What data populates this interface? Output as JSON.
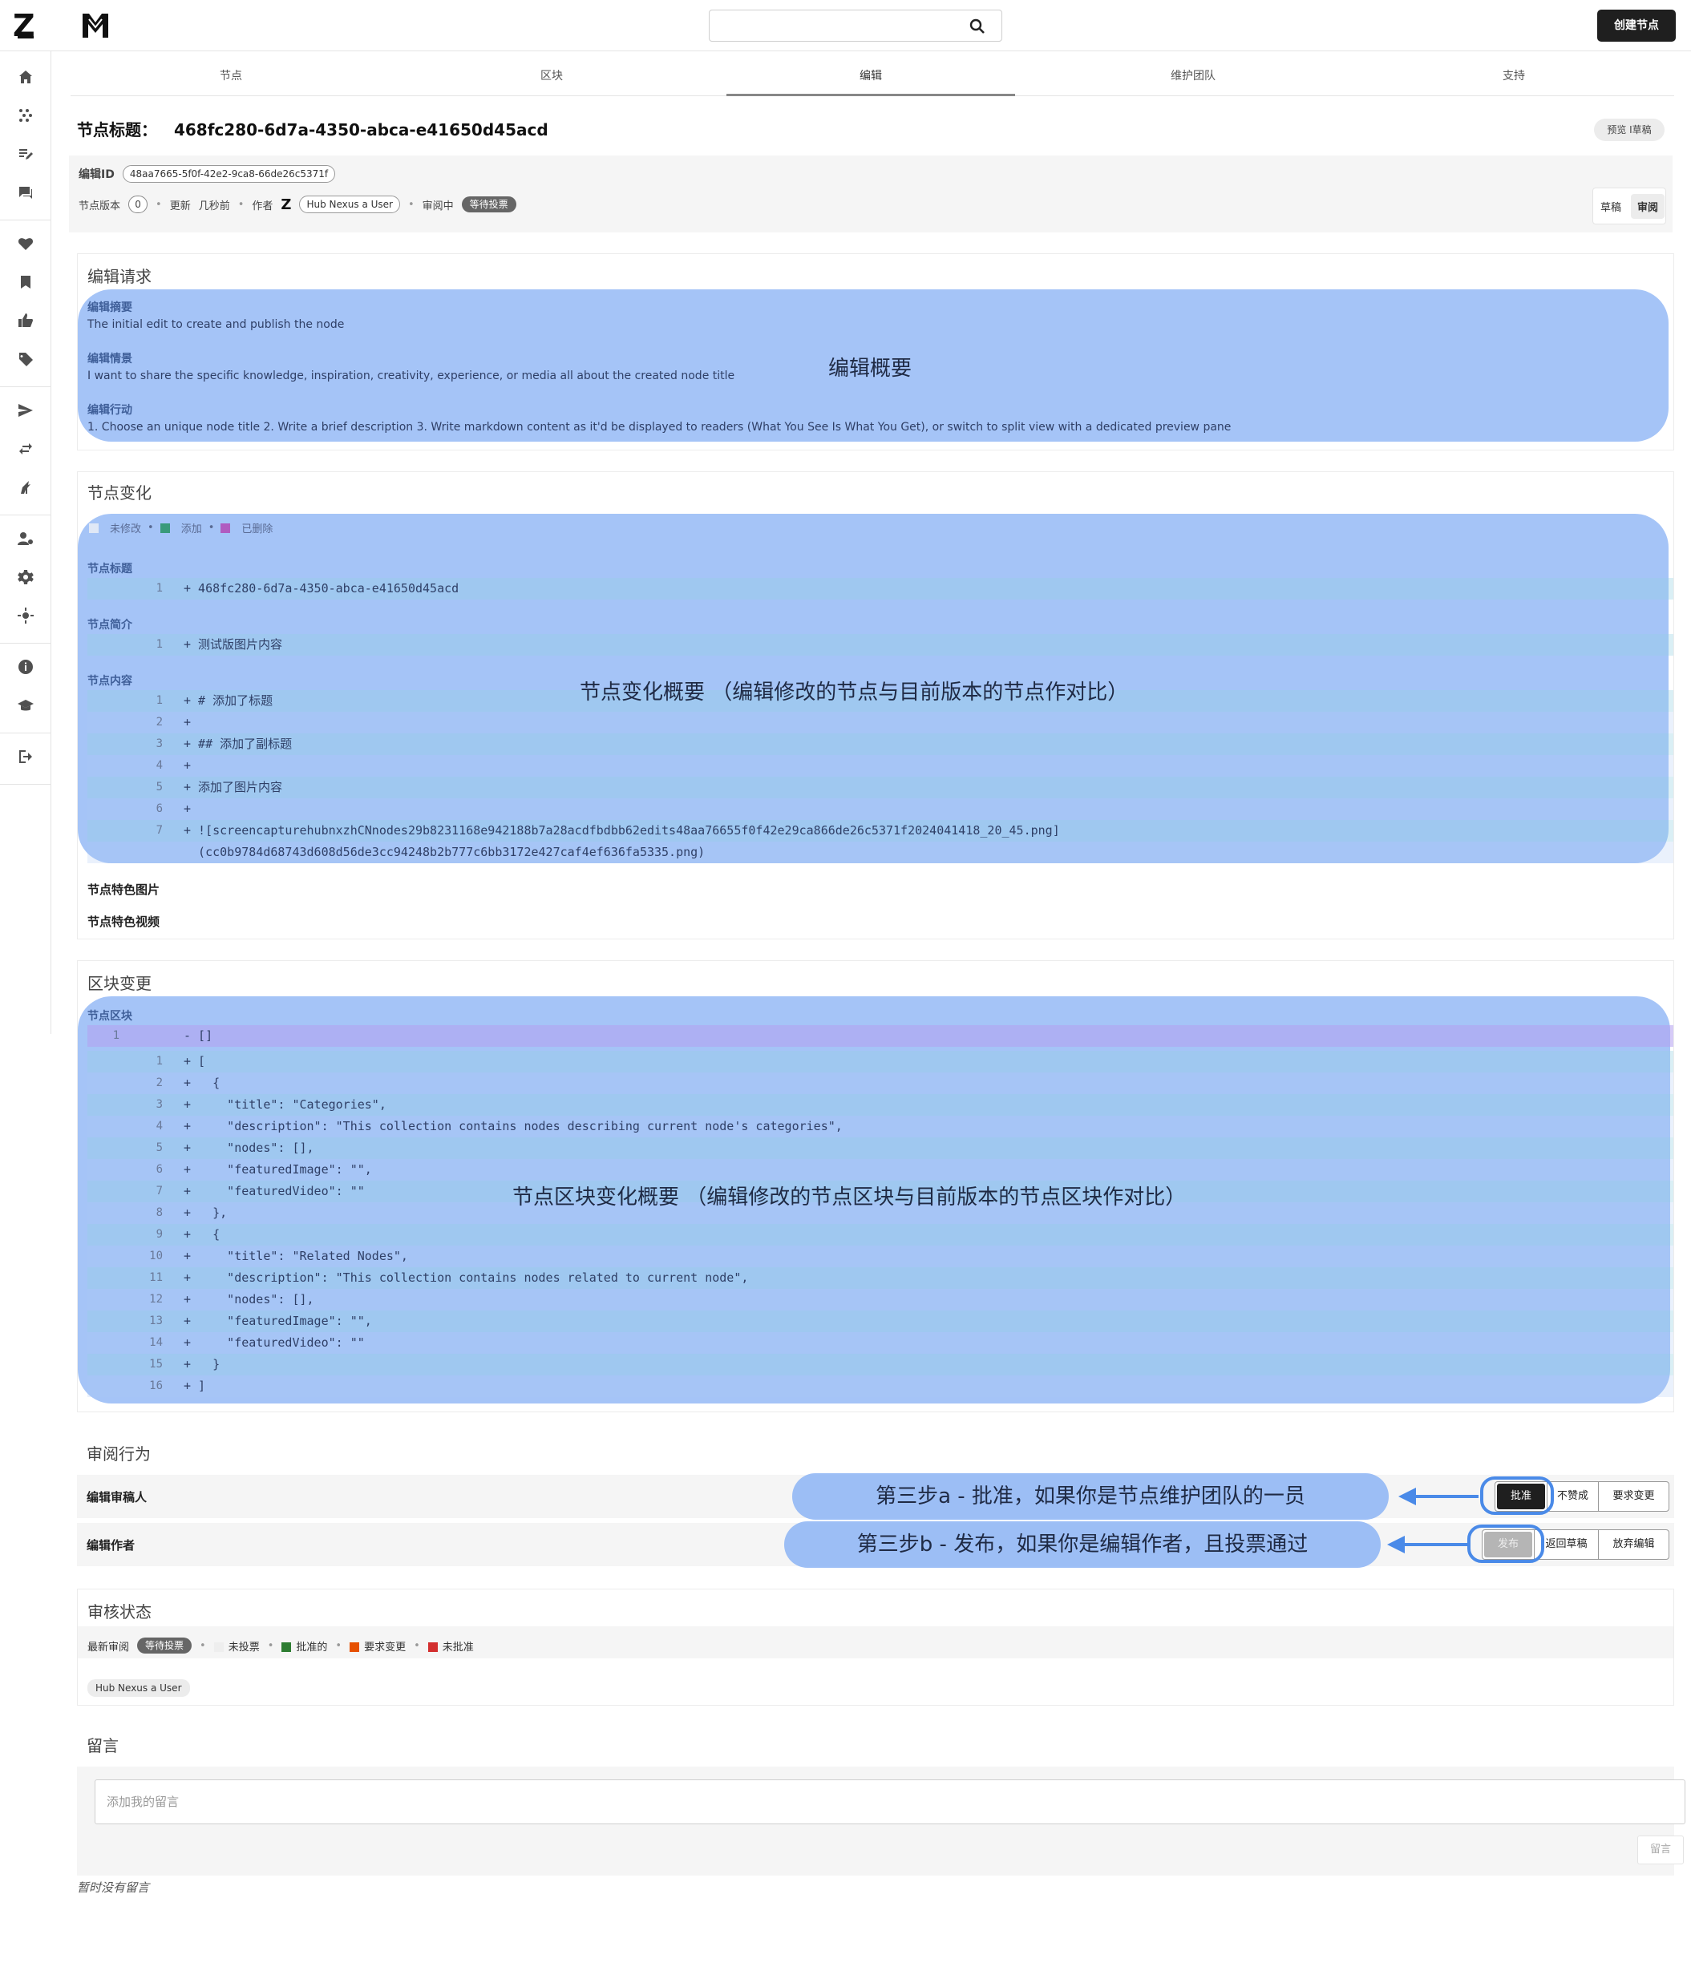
{
  "header": {
    "logo_alt": "Z",
    "search_placeholder": "",
    "create_node_label": "创建节点"
  },
  "sidebar": {
    "icons": [
      "home-icon",
      "network-icon",
      "edit-list-icon",
      "chat-icon",
      "heart-icon",
      "bookmark-icon",
      "thumbs-up-icon",
      "tag-icon",
      "send-icon",
      "swap-icon",
      "dragon-icon",
      "user-settings-icon",
      "gear-icon",
      "sun-icon",
      "info-icon",
      "graduation-cap-icon",
      "logout-icon"
    ]
  },
  "tabs": [
    "节点",
    "区块",
    "编辑",
    "维护团队",
    "支持"
  ],
  "node_title": {
    "label": "节点标题：",
    "value": "468fc280-6d7a-4350-abca-e41650d45acd"
  },
  "preview_button": "预览 I草稿",
  "meta": {
    "edit_id_label": "编辑ID",
    "edit_id_value": "48aa7665-5f0f-42e2-9ca8-66de26c5371f",
    "version_label": "节点版本",
    "version_value": "0",
    "updated_label": "更新",
    "updated_value": "几秒前",
    "author_label": "作者",
    "author_name": "Hub Nexus a User",
    "status_label": "审阅中",
    "status_badge": "等待投票",
    "mode_draft": "草稿",
    "mode_review": "审阅"
  },
  "edit_request": {
    "title": "编辑请求",
    "overlay_label": "编辑概要",
    "summary_label": "编辑摘要",
    "summary_text": "The initial edit to create and publish the node",
    "scenario_label": "编辑情景",
    "scenario_text": "I want to share the specific knowledge, inspiration, creativity, experience, or media all about the created node title",
    "action_label": "编辑行动",
    "action_text": "1. Choose an unique node title 2. Write a brief description 3. Write markdown content as it'd be displayed to readers (What You See Is What You Get), or switch to split view with a dedicated preview pane"
  },
  "node_changes": {
    "title": "节点变化",
    "overlay_label": "节点变化概要  （编辑修改的节点与目前版本的节点作对比）",
    "legend": [
      "未修改",
      "添加",
      "已删除"
    ],
    "title_label": "节点标题",
    "title_diff": [
      {
        "num": "1",
        "text": "+ 468fc280-6d7a-4350-abca-e41650d45acd"
      }
    ],
    "intro_label": "节点简介",
    "intro_diff": [
      {
        "num": "1",
        "text": "+ 测试版图片内容"
      }
    ],
    "content_label": "节点内容",
    "content_diff": [
      {
        "num": "1",
        "text": "+ # 添加了标题"
      },
      {
        "num": "2",
        "text": "+"
      },
      {
        "num": "3",
        "text": "+ ## 添加了副标题"
      },
      {
        "num": "4",
        "text": "+"
      },
      {
        "num": "5",
        "text": "+ 添加了图片内容"
      },
      {
        "num": "6",
        "text": "+"
      },
      {
        "num": "7",
        "text": "+ ![screencapturehubnxzhCNnodes29b8231168e942188b7a28acdfbdbb62edits48aa76655f0f42e29ca866de26c5371f2024041418_20_45.png]"
      },
      {
        "num": "",
        "text": "  (cc0b9784d68743d608d56de3cc94248b2b777c6bb3172e427caf4ef636fa5335.png)"
      }
    ],
    "featured_image_label": "节点特色图片",
    "featured_video_label": "节点特色视频"
  },
  "block_changes": {
    "title": "区块变更",
    "overlay_label": "节点区块变化概要  （编辑修改的节点区块与目前版本的节点区块作对比）",
    "blocks_label": "节点区块",
    "removed_row": {
      "num": "1",
      "text": "- []"
    },
    "added_rows": [
      {
        "num": "1",
        "text": "+ ["
      },
      {
        "num": "2",
        "text": "+   {"
      },
      {
        "num": "3",
        "text": "+     \"title\": \"Categories\","
      },
      {
        "num": "4",
        "text": "+     \"description\": \"This collection contains nodes describing current node's categories\","
      },
      {
        "num": "5",
        "text": "+     \"nodes\": [],"
      },
      {
        "num": "6",
        "text": "+     \"featuredImage\": \"\","
      },
      {
        "num": "7",
        "text": "+     \"featuredVideo\": \"\""
      },
      {
        "num": "8",
        "text": "+   },"
      },
      {
        "num": "9",
        "text": "+   {"
      },
      {
        "num": "10",
        "text": "+     \"title\": \"Related Nodes\","
      },
      {
        "num": "11",
        "text": "+     \"description\": \"This collection contains nodes related to current node\","
      },
      {
        "num": "12",
        "text": "+     \"nodes\": [],"
      },
      {
        "num": "13",
        "text": "+     \"featuredImage\": \"\","
      },
      {
        "num": "14",
        "text": "+     \"featuredVideo\": \"\""
      },
      {
        "num": "15",
        "text": "+   }"
      },
      {
        "num": "16",
        "text": "+ ]"
      }
    ]
  },
  "review_actions": {
    "title": "审阅行为",
    "reviewer_label": "编辑审稿人",
    "reviewer_callout": "第三步a - 批准，如果你是节点维护团队的一员",
    "reviewer_buttons": [
      "批准",
      "不赞成",
      "要求变更"
    ],
    "author_label": "编辑作者",
    "author_callout": "第三步b - 发布，如果你是编辑作者，且投票通过",
    "author_buttons": [
      "发布",
      "返回草稿",
      "放弃编辑"
    ]
  },
  "review_status": {
    "title": "审核状态",
    "latest_label": "最新审阅",
    "latest_badge": "等待投票",
    "legend": [
      "未投票",
      "批准的",
      "要求变更",
      "未批准"
    ],
    "reviewer_chip": "Hub Nexus a User"
  },
  "comments": {
    "title": "留言",
    "placeholder": "添加我的留言",
    "submit_label": "留言",
    "empty_text": "暂时没有留言"
  },
  "colors": {
    "overlay": "#8cb4f5",
    "arrow": "#4a8ae8",
    "added": "#2e7d32",
    "requested": "#e65100",
    "rejected": "#d32f2f",
    "deleted": "#ab47bc"
  }
}
